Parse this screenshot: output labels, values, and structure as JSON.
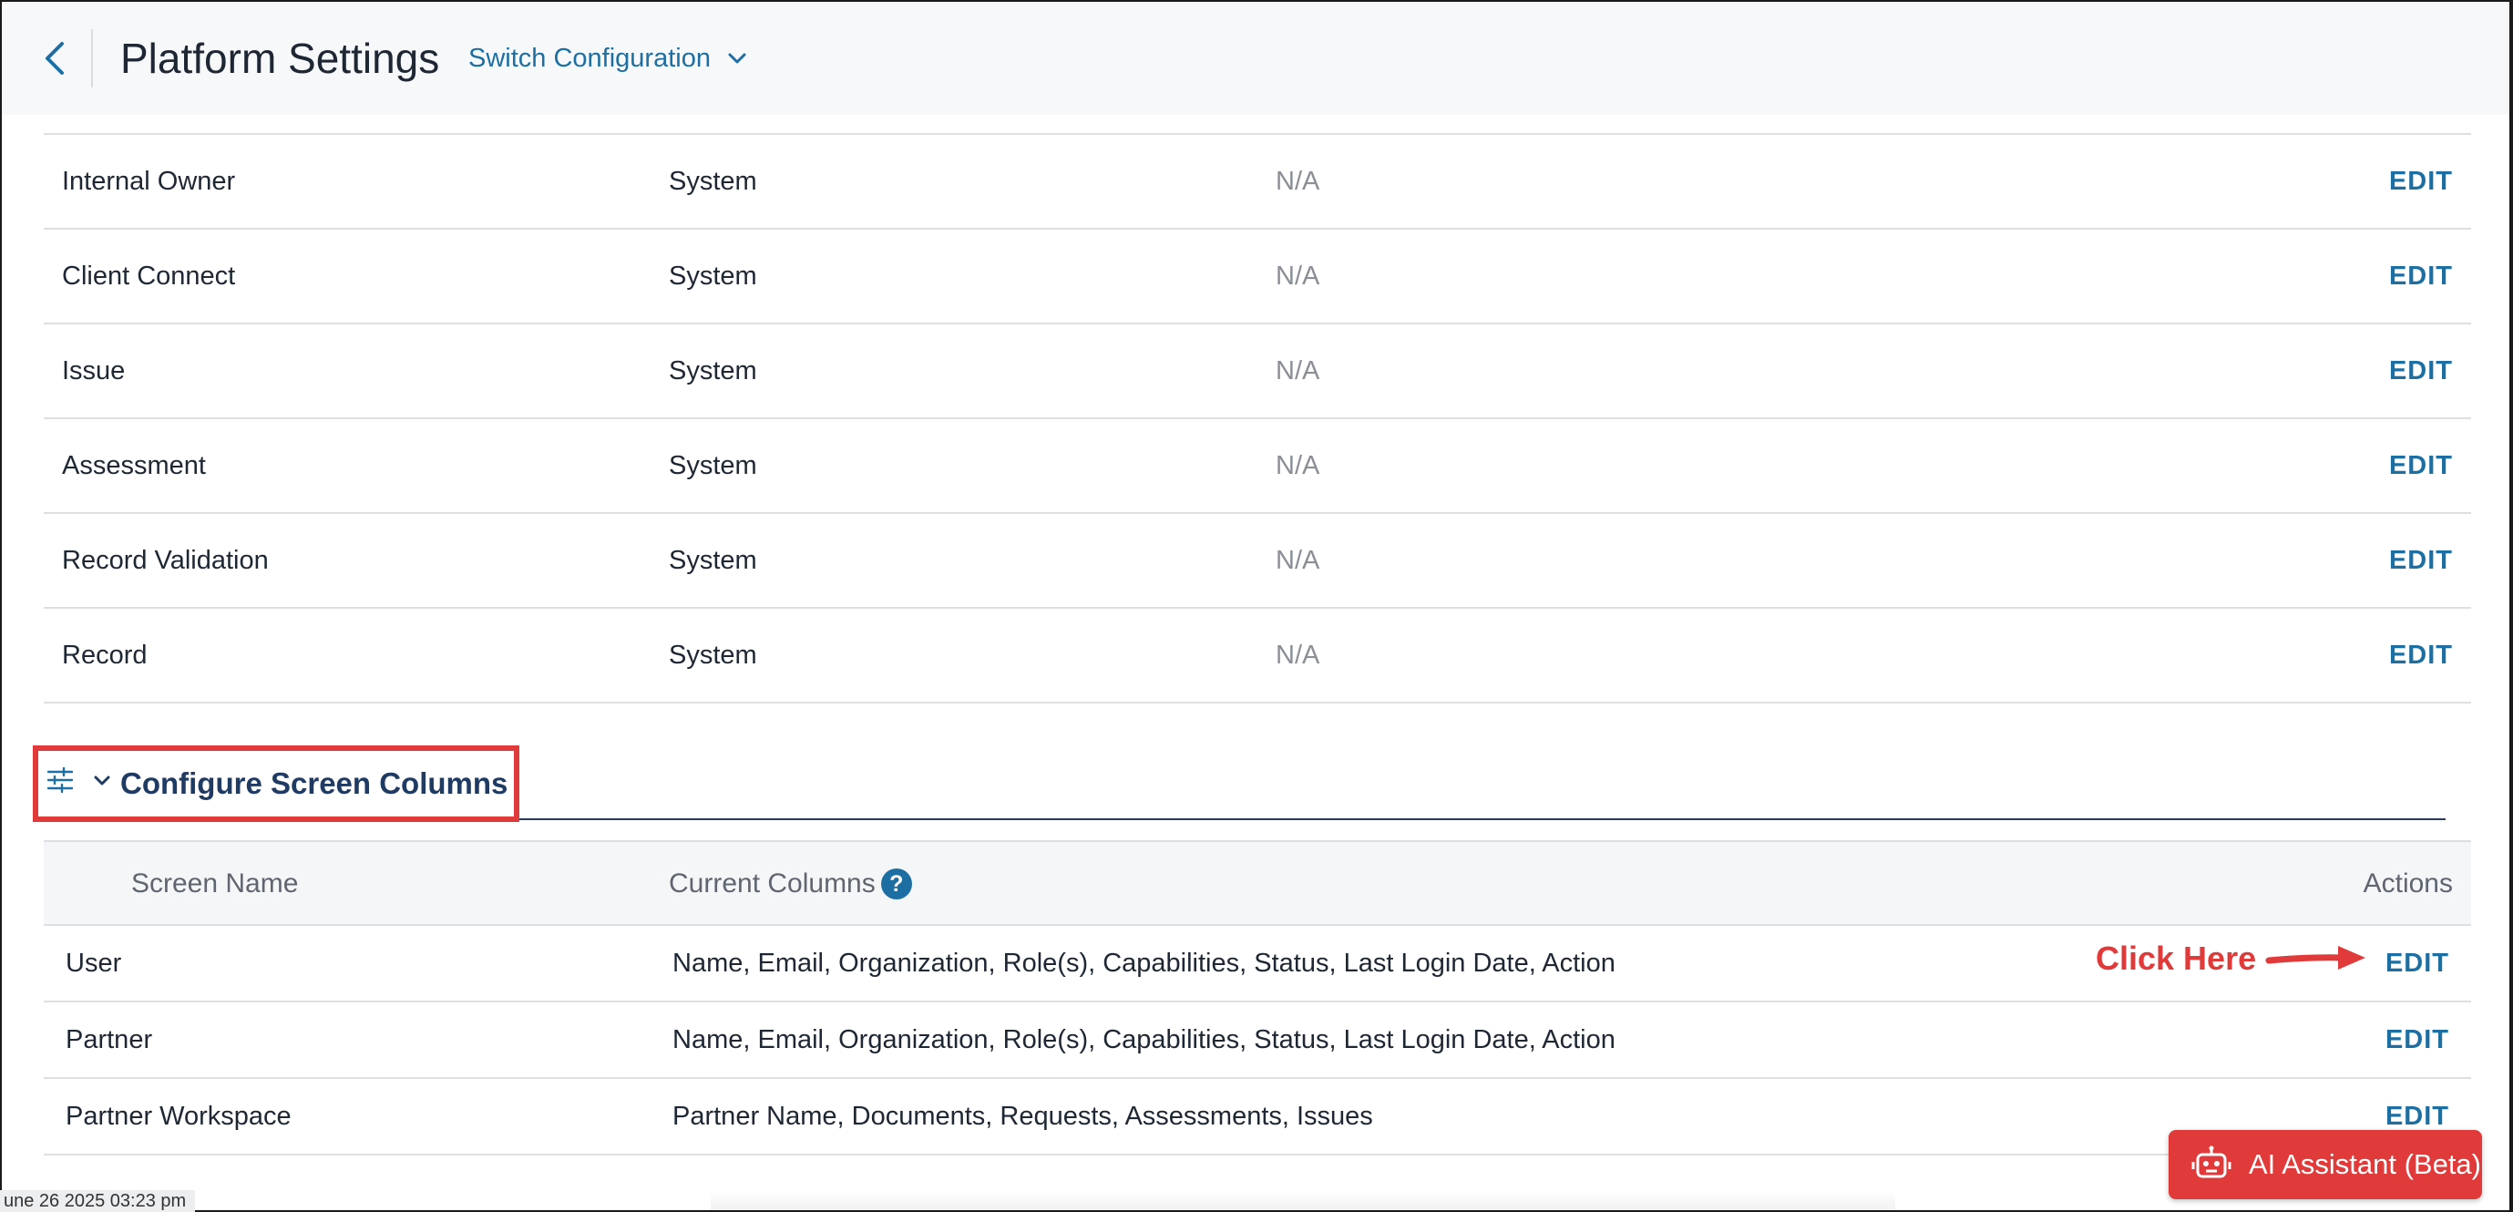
{
  "header": {
    "title": "Platform Settings",
    "switch_label": "Switch Configuration"
  },
  "settings_rows": [
    {
      "name": "Internal Owner",
      "type": "System",
      "value": "N/A",
      "action": "EDIT"
    },
    {
      "name": "Client Connect",
      "type": "System",
      "value": "N/A",
      "action": "EDIT"
    },
    {
      "name": "Issue",
      "type": "System",
      "value": "N/A",
      "action": "EDIT"
    },
    {
      "name": "Assessment",
      "type": "System",
      "value": "N/A",
      "action": "EDIT"
    },
    {
      "name": "Record Validation",
      "type": "System",
      "value": "N/A",
      "action": "EDIT"
    },
    {
      "name": "Record",
      "type": "System",
      "value": "N/A",
      "action": "EDIT"
    }
  ],
  "section": {
    "title": "Configure Screen Columns"
  },
  "columns_table": {
    "headers": {
      "screen_name": "Screen Name",
      "current_columns": "Current Columns",
      "actions": "Actions",
      "help_glyph": "?"
    },
    "rows": [
      {
        "screen": "User",
        "columns": "Name, Email, Organization, Role(s), Capabilities, Status, Last Login Date, Action",
        "action": "EDIT"
      },
      {
        "screen": "Partner",
        "columns": "Name, Email, Organization, Role(s), Capabilities, Status, Last Login Date, Action",
        "action": "EDIT"
      },
      {
        "screen": "Partner Workspace",
        "columns": "Partner Name, Documents, Requests, Assessments, Issues",
        "action": "EDIT"
      }
    ]
  },
  "annotation": {
    "text": "Click Here",
    "color": "#e03a3a"
  },
  "timestamp": "une 26 2025 03:23 pm",
  "ai_assistant": {
    "label": "AI Assistant (Beta)",
    "icon": "robot-icon",
    "color": "#e03a3a"
  },
  "colors": {
    "accent": "#1d6fa3",
    "section_title": "#1f3a63",
    "highlight": "#e03a3a"
  },
  "icons": {
    "back": "chevron-left-icon",
    "switch": "chevron-down-icon",
    "section_settings": "sliders-icon",
    "section_toggle": "chevron-down-icon",
    "help": "question-circle-icon"
  }
}
